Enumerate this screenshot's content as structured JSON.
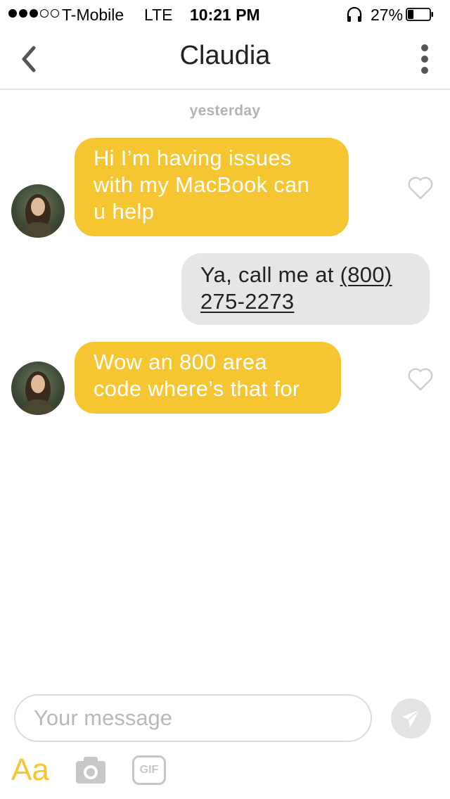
{
  "status_bar": {
    "carrier": "T-Mobile",
    "network": "LTE",
    "time": "10:21 PM",
    "battery_percent": "27%",
    "battery_level": 0.27,
    "signal_bars_filled": 3,
    "signal_bars_total": 5
  },
  "header": {
    "title": "Claudia",
    "back_icon": "chevron-left-icon",
    "menu_icon": "vertical-dots-icon"
  },
  "conversation": {
    "date_divider": "yesterday",
    "messages": [
      {
        "direction": "incoming",
        "text": "Hi I’m having issues\nwith my MacBook can\nu help",
        "liked": false
      },
      {
        "direction": "outgoing",
        "text_prefix": "Ya, call me at ",
        "phone_line1": "(800)",
        "phone_line2": "275-2273"
      },
      {
        "direction": "incoming",
        "text": "Wow an 800 area\ncode where’s that for",
        "liked": false
      }
    ]
  },
  "composer": {
    "placeholder": "Your message",
    "value": "",
    "text_format_label": "Aa",
    "gif_label": "GIF",
    "send_icon": "paper-plane-icon",
    "camera_icon": "camera-icon"
  },
  "colors": {
    "incoming_bubble": "#f6c532",
    "outgoing_bubble": "#e6e6e6",
    "accent": "#f6c532"
  }
}
